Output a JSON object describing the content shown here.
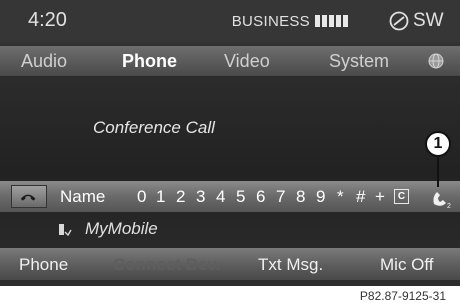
{
  "status": {
    "time": "4:20",
    "carrier": "BUSINESS",
    "signal_bars": 5,
    "network": "SW"
  },
  "menu": {
    "audio": "Audio",
    "phone": "Phone",
    "video": "Video",
    "system": "System"
  },
  "call": {
    "title": "Conference Call"
  },
  "callout": "1",
  "char_bar": {
    "name": "Name",
    "chars": [
      "0",
      "1",
      "2",
      "3",
      "4",
      "5",
      "6",
      "7",
      "8",
      "9",
      "*",
      "#",
      "+"
    ],
    "clear": "C"
  },
  "entry": {
    "name": "MyMobile"
  },
  "softkeys": {
    "phone": "Phone",
    "connect": "Connect Dev.",
    "txt": "Txt Msg.",
    "mic": "Mic Off"
  },
  "figure_ref": "P82.87-9125-31"
}
